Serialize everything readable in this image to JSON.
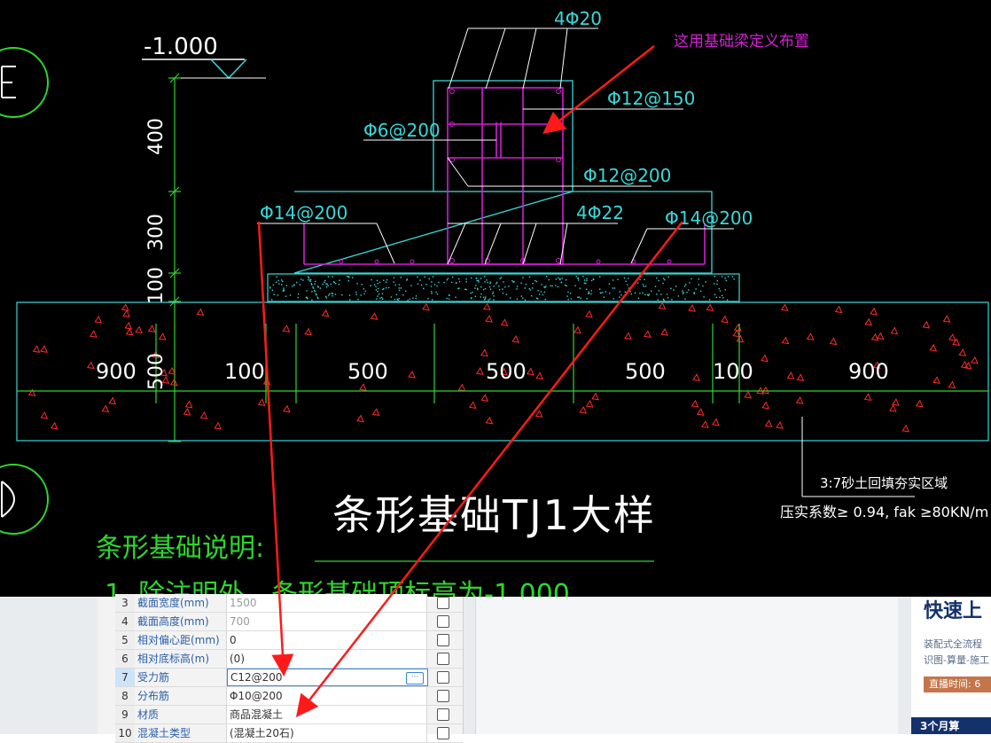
{
  "drawing": {
    "elevation": "-1.000",
    "rebar_top": "4Φ20",
    "annotation": "这用基础梁定义布置",
    "rebar_phi12_150": "Φ12@150",
    "rebar_phi6_200": "Φ6@200",
    "rebar_phi12_200": "Φ12@200",
    "rebar_phi14_left": "Φ14@200",
    "rebar_4phi22": "4Φ22",
    "rebar_phi14_right": "Φ14@200",
    "dim_400": "400",
    "dim_300": "300",
    "dim_100": "100",
    "dim_500": "500",
    "widths": [
      "900",
      "100",
      "500",
      "500",
      "500",
      "100",
      "900"
    ],
    "backfill_note": "3:7砂土回填夯实区域",
    "compaction_note": "压实系数≥ 0.94, fak ≥80KN/m",
    "title": "条形基础TJ1大样",
    "notes_heading": "条形基础说明:",
    "notes_line1": "1. 除注明外，条形基础顶标高为-1.000"
  },
  "properties": {
    "rows": [
      {
        "num": "3",
        "name": "截面宽度(mm)",
        "value": "1500",
        "muted": true
      },
      {
        "num": "4",
        "name": "截面高度(mm)",
        "value": "700",
        "muted": true
      },
      {
        "num": "5",
        "name": "相对偏心距(mm)",
        "value": "0",
        "muted": false
      },
      {
        "num": "6",
        "name": "相对底标高(m)",
        "value": "(0)",
        "muted": false
      },
      {
        "num": "7",
        "name": "受力筋",
        "value": "C12@200",
        "muted": false
      },
      {
        "num": "8",
        "name": "分布筋",
        "value": "Φ10@200",
        "muted": false
      },
      {
        "num": "9",
        "name": "材质",
        "value": "商品混凝土",
        "muted": false
      },
      {
        "num": "10",
        "name": "混凝土类型",
        "value": "(混凝土20石)",
        "muted": false
      }
    ],
    "more_button": "···"
  },
  "ad": {
    "title": "快速上",
    "line1": "装配式全流程",
    "line2": "识图-算量-施工",
    "live_label": "直播时间: 6",
    "next_title": "3个月算"
  },
  "colors": {
    "cad_bg": "#000000",
    "cyan": "#39d7d7",
    "green": "#2fd62f",
    "magenta": "#d21fd2",
    "red_arrow": "#ff1a1a",
    "white_text": "#ffffff"
  }
}
